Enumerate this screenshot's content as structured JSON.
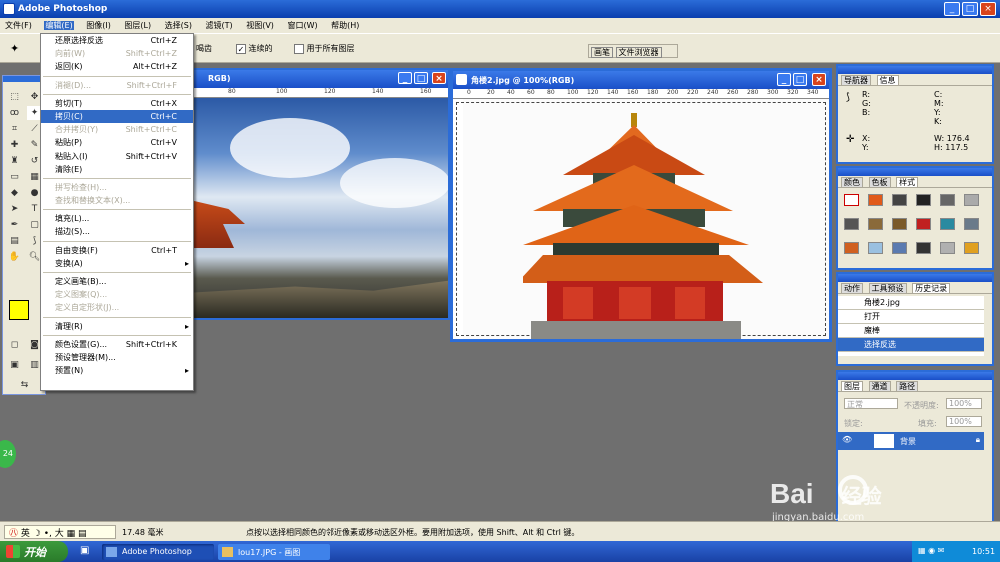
{
  "app": {
    "title": "Adobe Photoshop"
  },
  "menus": [
    "文件(F)",
    "编辑(E)",
    "图像(I)",
    "图层(L)",
    "选择(S)",
    "滤镜(T)",
    "视图(V)",
    "窗口(W)",
    "帮助(H)"
  ],
  "options_bar": {
    "partial_label": "喝齿",
    "contiguous_label": "连续的",
    "all_layers_label": "用于所有图层",
    "brush_tab": "画笔",
    "file_browser_tab": "文件浏览器"
  },
  "edit_menu": [
    {
      "label": "还原选择反选",
      "shortcut": "Ctrl+Z",
      "state": "normal"
    },
    {
      "label": "向前(W)",
      "shortcut": "Shift+Ctrl+Z",
      "state": "disabled"
    },
    {
      "label": "返回(K)",
      "shortcut": "Alt+Ctrl+Z",
      "state": "normal"
    },
    {
      "sep": true
    },
    {
      "label": "消褪(D)...",
      "shortcut": "Shift+Ctrl+F",
      "state": "disabled"
    },
    {
      "sep": true
    },
    {
      "label": "剪切(T)",
      "shortcut": "Ctrl+X",
      "state": "normal"
    },
    {
      "label": "拷贝(C)",
      "shortcut": "Ctrl+C",
      "state": "highlight"
    },
    {
      "label": "合并拷贝(Y)",
      "shortcut": "Shift+Ctrl+C",
      "state": "disabled"
    },
    {
      "label": "粘贴(P)",
      "shortcut": "Ctrl+V",
      "state": "normal"
    },
    {
      "label": "粘贴入(I)",
      "shortcut": "Shift+Ctrl+V",
      "state": "normal"
    },
    {
      "label": "清除(E)",
      "shortcut": "",
      "state": "normal"
    },
    {
      "sep": true
    },
    {
      "label": "拼写检查(H)...",
      "shortcut": "",
      "state": "disabled"
    },
    {
      "label": "查找和替换文本(X)...",
      "shortcut": "",
      "state": "disabled"
    },
    {
      "sep": true
    },
    {
      "label": "填充(L)...",
      "shortcut": "",
      "state": "normal"
    },
    {
      "label": "描边(S)...",
      "shortcut": "",
      "state": "normal"
    },
    {
      "sep": true
    },
    {
      "label": "自由变换(F)",
      "shortcut": "Ctrl+T",
      "state": "normal"
    },
    {
      "label": "变换(A)",
      "shortcut": "",
      "state": "normal",
      "submenu": true
    },
    {
      "sep": true
    },
    {
      "label": "定义画笔(B)...",
      "shortcut": "",
      "state": "normal"
    },
    {
      "label": "定义图案(Q)...",
      "shortcut": "",
      "state": "disabled"
    },
    {
      "label": "定义自定形状(J)...",
      "shortcut": "",
      "state": "disabled"
    },
    {
      "sep": true
    },
    {
      "label": "清理(R)",
      "shortcut": "",
      "state": "normal",
      "submenu": true
    },
    {
      "sep": true
    },
    {
      "label": "颜色设置(G)...",
      "shortcut": "Shift+Ctrl+K",
      "state": "normal"
    },
    {
      "label": "预设管理器(M)...",
      "shortcut": "",
      "state": "normal"
    },
    {
      "label": "预置(N)",
      "shortcut": "",
      "state": "normal",
      "submenu": true
    }
  ],
  "doc1": {
    "title_suffix": "RGB)",
    "ruler": [
      "80",
      "100",
      "120",
      "140",
      "160"
    ]
  },
  "doc2": {
    "title": "角楼2.jpg @ 100%(RGB)",
    "ruler": [
      "0",
      "20",
      "40",
      "60",
      "80",
      "100",
      "120",
      "140",
      "160",
      "180",
      "200",
      "220",
      "240",
      "260",
      "280",
      "300",
      "320",
      "340"
    ]
  },
  "navigator": {
    "tabs": [
      "导航器",
      "信息"
    ],
    "r": "R:",
    "g": "G:",
    "b": "B:",
    "c": "C:",
    "m": "M:",
    "y": "Y:",
    "k": "K:",
    "x": "X:",
    "y2": "Y:",
    "w": "W:",
    "h": "H:",
    "w_val": "176.4",
    "h_val": "117.5"
  },
  "styles_panel": {
    "tabs": [
      "颜色",
      "色板",
      "样式"
    ]
  },
  "history_panel": {
    "tabs": [
      "动作",
      "工具预设",
      "历史记录"
    ],
    "snapshot": "角楼2.jpg",
    "items": [
      "打开",
      "魔棒",
      "选择反选"
    ]
  },
  "layers_panel": {
    "tabs": [
      "图层",
      "通道",
      "路径"
    ],
    "blend_mode": "正常",
    "opacity_label": "不透明度:",
    "opacity_value": "100%",
    "lock_label": "锁定:",
    "fill_label": "填充:",
    "fill_value": "100%",
    "layer_name": "背景"
  },
  "status": {
    "zoom": "17.48 毫米",
    "hint": "点按以选择相同颜色的邻近像素或移动选区外框。要用附加选项，使用 Shift、Alt 和 Ctrl 键。",
    "ime": "英"
  },
  "taskbar": {
    "start": "开始",
    "task1": "Adobe Photoshop",
    "task2": "lou17.JPG - 画图",
    "time": "10:51"
  },
  "badge": "24",
  "watermark": {
    "brand": "Bai",
    "brand2": "经验",
    "url": "jingyan.baidu.com"
  },
  "colors": {
    "foreground": "#ffff00",
    "background": "#1a1ad9",
    "xp_blue": "#2b6cd8",
    "highlight": "#316ac5"
  }
}
